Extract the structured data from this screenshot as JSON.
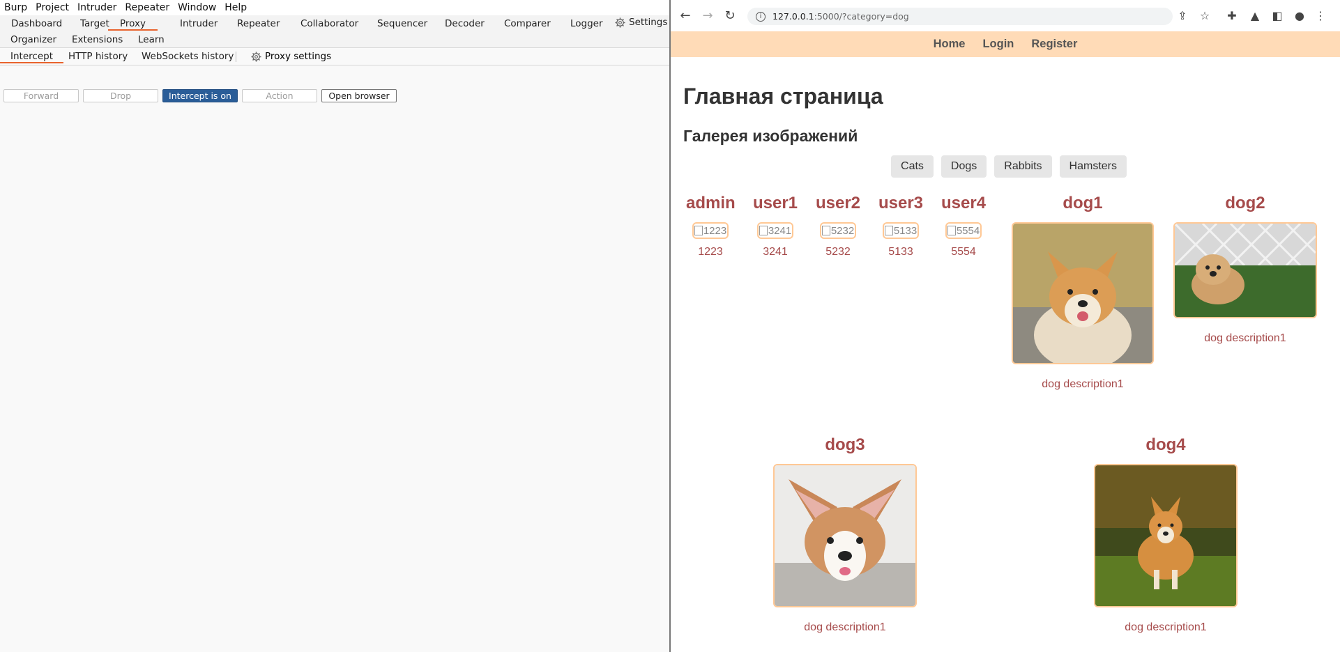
{
  "burp": {
    "menu": [
      "Burp",
      "Project",
      "Intruder",
      "Repeater",
      "Window",
      "Help"
    ],
    "tabs_row1": [
      "Dashboard",
      "Target",
      "Proxy",
      "Intruder",
      "Repeater",
      "Collaborator",
      "Sequencer",
      "Decoder",
      "Comparer",
      "Logger"
    ],
    "tabs_row2": [
      "Organizer",
      "Extensions",
      "Learn"
    ],
    "settings_label": "Settings",
    "active_tab": "Proxy",
    "proxy_tabs": [
      "Intercept",
      "HTTP history",
      "WebSockets history"
    ],
    "proxy_settings_label": "Proxy settings",
    "buttons": {
      "forward": "Forward",
      "drop": "Drop",
      "intercept": "Intercept is on",
      "action": "Action",
      "open_browser": "Open browser"
    },
    "accent_color": "#e8632d",
    "primary_button_color": "#2a5d98"
  },
  "browser": {
    "url_host": "127.0.0.1",
    "url_rest": ":5000/?category=dog",
    "nav": [
      "Home",
      "Login",
      "Register"
    ],
    "nav_bg": "#ffdbb7",
    "heading": "Главная страница",
    "subheading": "Галерея изображений",
    "categories": [
      "Cats",
      "Dogs",
      "Rabbits",
      "Hamsters"
    ],
    "users": [
      {
        "name": "admin",
        "img_alt": "1223",
        "caption": "1223"
      },
      {
        "name": "user1",
        "img_alt": "3241",
        "caption": "3241"
      },
      {
        "name": "user2",
        "img_alt": "5232",
        "caption": "5232"
      },
      {
        "name": "user3",
        "img_alt": "5133",
        "caption": "5133"
      },
      {
        "name": "user4",
        "img_alt": "5554",
        "caption": "5554"
      }
    ],
    "dogs": [
      {
        "name": "dog1",
        "description": "dog description1"
      },
      {
        "name": "dog2",
        "description": "dog description1"
      },
      {
        "name": "dog3",
        "description": "dog description1"
      },
      {
        "name": "dog4",
        "description": "dog description1"
      }
    ],
    "title_color": "#a64b4b",
    "image_border_color": "#ffc895"
  }
}
